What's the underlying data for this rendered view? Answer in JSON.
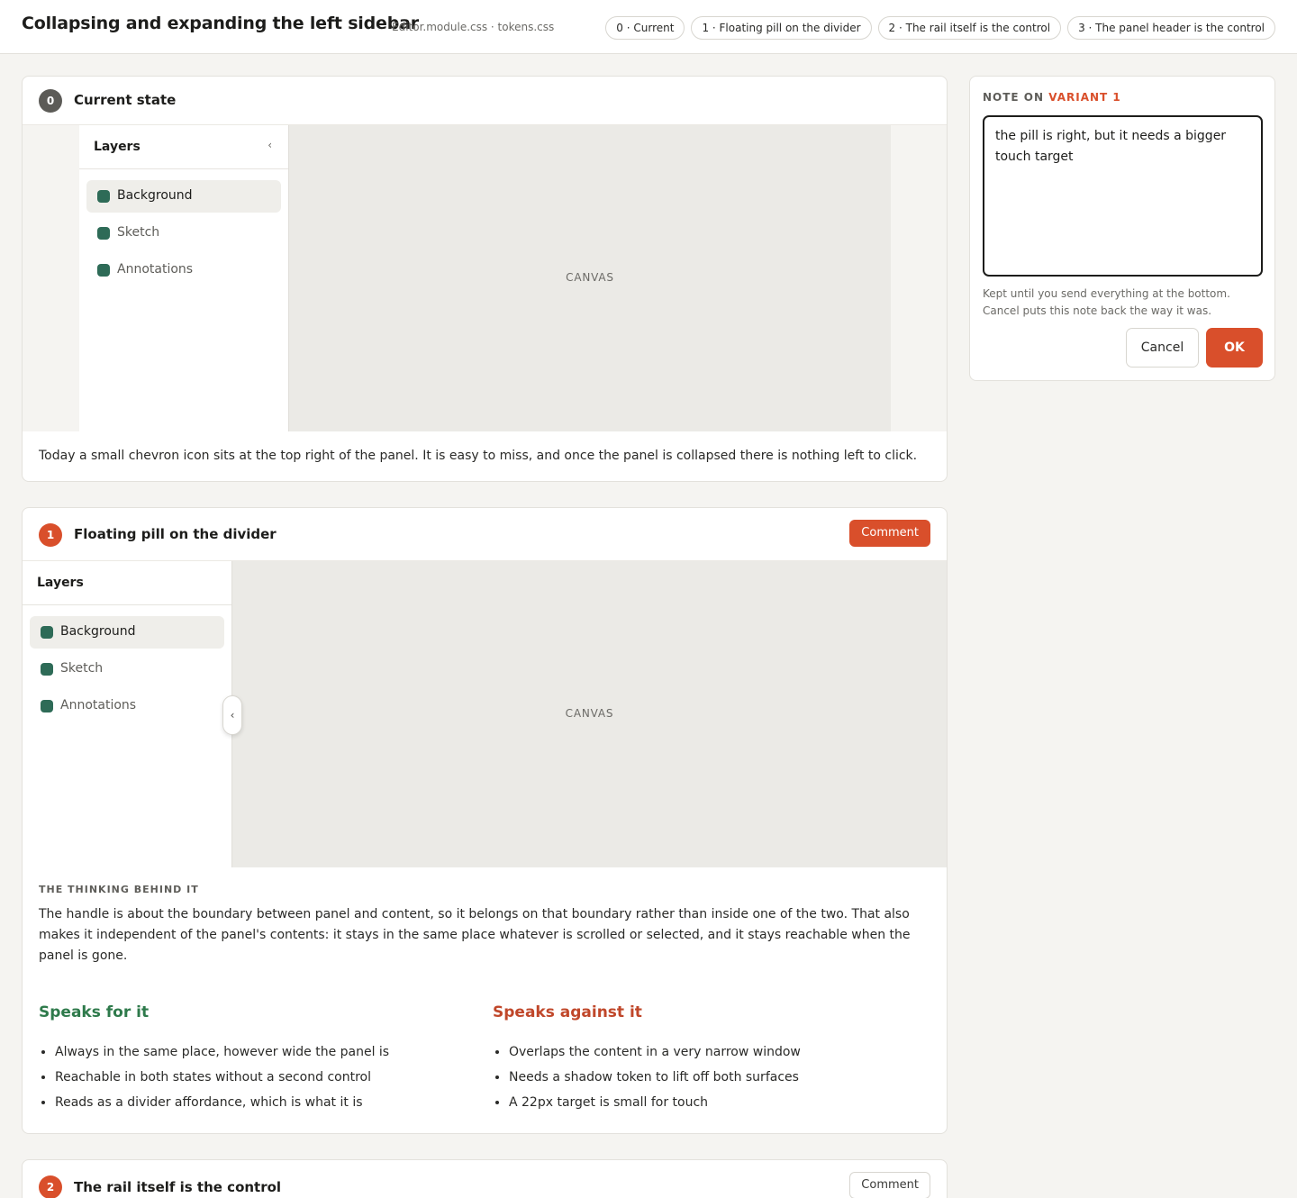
{
  "header": {
    "title": "Collapsing and expanding the left sidebar",
    "files": "Editor.module.css · tokens.css",
    "chips": [
      "0 · Current",
      "1 · Floating pill on the divider",
      "2 · The rail itself is the control",
      "3 · The panel header is the control"
    ]
  },
  "variants": [
    {
      "number": "0",
      "title": "Current state",
      "panel_title": "Layers",
      "collapse_glyph": "‹",
      "layers": [
        "Background",
        "Sketch",
        "Annotations"
      ],
      "canvas_label": "CANVAS",
      "description": "Today a small chevron icon sits at the top right of the panel. It is easy to miss, and once the panel is collapsed there is nothing left to click."
    },
    {
      "number": "1",
      "title": "Floating pill on the divider",
      "comment_label": "Comment",
      "panel_title": "Layers",
      "pill_glyph": "‹",
      "layers": [
        "Background",
        "Sketch",
        "Annotations"
      ],
      "canvas_label": "CANVAS",
      "kicker": "THE THINKING BEHIND IT",
      "thinking": "The handle is about the boundary between panel and content, so it belongs on that boundary rather than inside one of the two. That also makes it independent of the panel's contents: it stays in the same place whatever is scrolled or selected, and it stays reachable when the panel is gone.",
      "for_title": "Speaks for it",
      "for_items": [
        "Always in the same place, however wide the panel is",
        "Reachable in both states without a second control",
        "Reads as a divider affordance, which is what it is"
      ],
      "against_title": "Speaks against it",
      "against_items": [
        "Overlaps the content in a very narrow window",
        "Needs a shadow token to lift off both surfaces",
        "A 22px target is small for touch"
      ]
    },
    {
      "number": "2",
      "title": "The rail itself is the control",
      "comment_label": "Comment"
    }
  ],
  "note": {
    "heading_prefix": "NOTE ON",
    "heading_variant": "VARIANT 1",
    "text": "the pill is right, but it needs a bigger touch target",
    "hint": "Kept until you send everything at the bottom. Cancel puts this note back the way it was.",
    "cancel_label": "Cancel",
    "ok_label": "OK"
  },
  "colors": {
    "accent": "#d94f2b",
    "layer_dot": "#2e6b57",
    "pro": "#2e7a4b",
    "con": "#c0472a"
  }
}
